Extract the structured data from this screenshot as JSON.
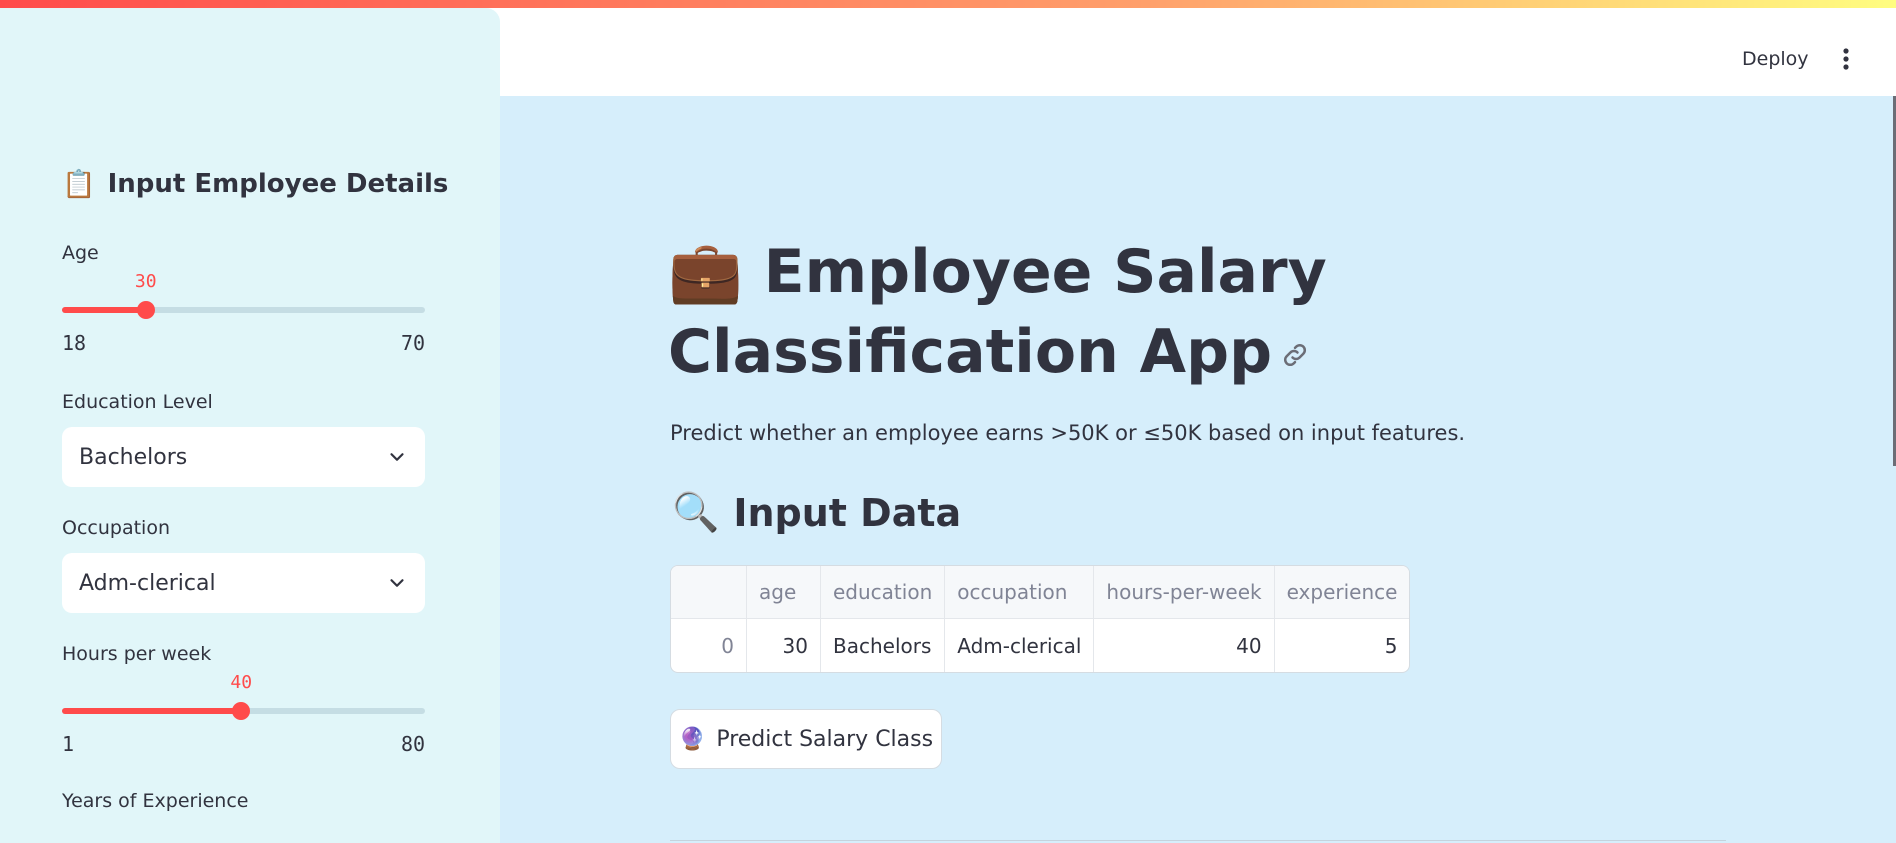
{
  "sidebar": {
    "title_emoji": "📋",
    "title": "Input Employee Details",
    "age": {
      "label": "Age",
      "value": "30",
      "min": "18",
      "max": "70",
      "fraction": 0.2308
    },
    "education": {
      "label": "Education Level",
      "value": "Bachelors"
    },
    "occupation": {
      "label": "Occupation",
      "value": "Adm-clerical"
    },
    "hours": {
      "label": "Hours per week",
      "value": "40",
      "min": "1",
      "max": "80",
      "fraction": 0.4937
    },
    "experience": {
      "label": "Years of Experience"
    }
  },
  "header": {
    "deploy_label": "Deploy",
    "menu_icon": "vertical-ellipsis-icon"
  },
  "main": {
    "title_emoji": "💼",
    "title": "Employee Salary Classification App",
    "title_link_icon": "link-icon",
    "subtitle": "Predict whether an employee earns >50K or ≤50K based on input features.",
    "section_emoji": "🔍",
    "section_title": "Input Data",
    "table": {
      "columns": [
        "",
        "age",
        "education",
        "occupation",
        "hours-per-week",
        "experience"
      ],
      "rows": [
        [
          "0",
          "30",
          "Bachelors",
          "Adm-clerical",
          "40",
          "5"
        ]
      ]
    },
    "predict_button": {
      "emoji": "🔮",
      "label": "Predict Salary Class"
    }
  },
  "colors": {
    "accent": "#ff4b4b",
    "sidebar_bg": "#e1f6f9",
    "main_bg": "#d6eefb",
    "text": "#31333f"
  }
}
